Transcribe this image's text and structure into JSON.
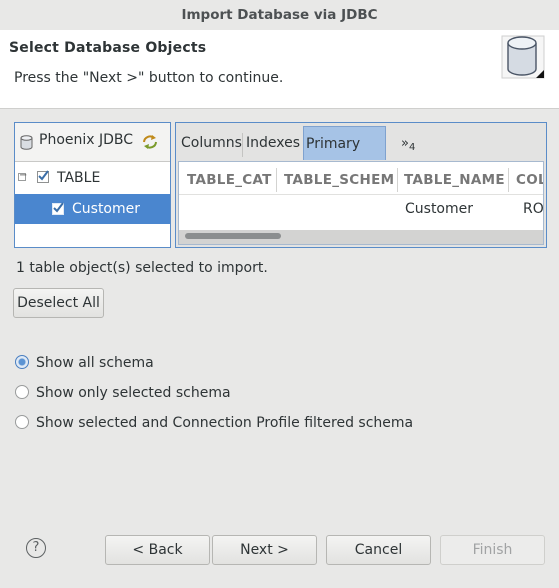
{
  "window": {
    "title": "Import Database via JDBC"
  },
  "header": {
    "title": "Select Database Objects",
    "description": "Press the \"Next >\" button to continue."
  },
  "tree": {
    "connection": "Phoenix JDBC",
    "nodes": [
      {
        "label": "TABLE",
        "checked": true,
        "expanded": true
      },
      {
        "label": "Customer",
        "checked": true,
        "selected": true
      }
    ]
  },
  "tabs": {
    "items": [
      "Columns",
      "Indexes",
      "Primary Key"
    ],
    "active": "Primary Key",
    "overflow_label": "»",
    "overflow_count": "4"
  },
  "grid": {
    "columns": [
      "TABLE_CAT",
      "TABLE_SCHEM",
      "TABLE_NAME",
      "COL"
    ],
    "rows": [
      [
        "",
        "",
        "Customer",
        "ROV"
      ]
    ]
  },
  "status": {
    "selected_text": "1 table object(s) selected to import."
  },
  "buttons": {
    "deselect_all": "Deselect All",
    "back": "< Back",
    "next": "Next >",
    "cancel": "Cancel",
    "finish": "Finish"
  },
  "schema_options": {
    "selected_index": 0,
    "items": [
      "Show all schema",
      "Show only selected schema",
      "Show selected and Connection Profile filtered schema"
    ]
  },
  "colors": {
    "accent": "#5a8cc8",
    "selection": "#4a86cf",
    "active_tab": "#a6c3e6"
  }
}
